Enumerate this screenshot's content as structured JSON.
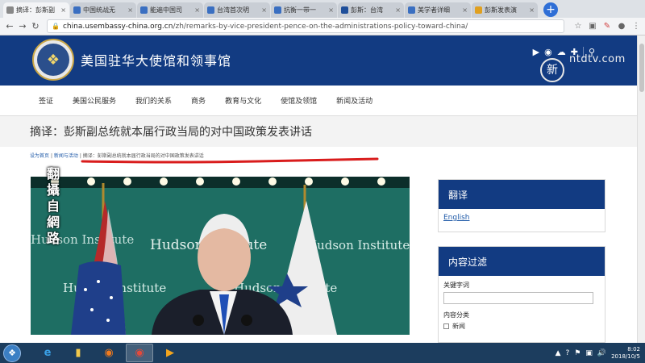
{
  "browser": {
    "tabs": [
      {
        "title": "摘译：彭斯副",
        "active": true,
        "color": "#888888"
      },
      {
        "title": "中国统战无",
        "active": false,
        "color": "#3a6fc1"
      },
      {
        "title": "能遍中国司",
        "active": false,
        "color": "#3a6fc1"
      },
      {
        "title": "台湾首次明",
        "active": false,
        "color": "#3a6fc1"
      },
      {
        "title": "抗衡一带一",
        "active": false,
        "color": "#3a6fc1"
      },
      {
        "title": "彭斯：台湾",
        "active": false,
        "color": "#1f4f9a"
      },
      {
        "title": "美学者详细",
        "active": false,
        "color": "#3a6fc1"
      },
      {
        "title": "彭斯发表演",
        "active": false,
        "color": "#e0a020"
      }
    ],
    "url_host": "china.usembassy-china.org.cn",
    "url_path": "/zh/remarks-by-vice-president-pence-on-the-administrations-policy-toward-china/"
  },
  "header": {
    "site_title": "美国驻华大使馆和领事馆",
    "icons": [
      "youtube-icon",
      "weibo-icon",
      "wechat-icon",
      "plus-icon",
      "search-icon"
    ]
  },
  "watermark": {
    "glyph": "新",
    "text": "ntdtv.com"
  },
  "nav": {
    "items": [
      "签证",
      "美国公民服务",
      "我们的关系",
      "商务",
      "教育与文化",
      "使馆及领馆",
      "新闻及活动"
    ]
  },
  "page": {
    "title": "摘译：彭斯副总统就本届行政当局的对中国政策发表讲话",
    "breadcrumb": {
      "home": "设为首页",
      "news": "新闻与活动",
      "current": "摘译：彭斯副总统就本届行政当局的对中国政策发表讲话"
    }
  },
  "overlay": {
    "vertical_text": [
      "翻",
      "攝",
      "自",
      "網",
      "路"
    ]
  },
  "photo": {
    "banner_text": "Hudson Institute",
    "colors": {
      "wall": "#1e6e63",
      "suit": "#1b1f2b",
      "tie": "#1f4fb6"
    }
  },
  "sidebar": {
    "translate": {
      "title": "翻译",
      "link": "English"
    },
    "filter": {
      "title": "内容过滤",
      "keyword_label": "关键字词",
      "category_label": "内容分类",
      "category_first": "新闻"
    }
  },
  "taskbar": {
    "apps": [
      "ie-icon",
      "folder-icon",
      "firefox-icon",
      "chrome-icon",
      "media-icon"
    ],
    "time": "8:02",
    "date": "2018/10/5"
  }
}
